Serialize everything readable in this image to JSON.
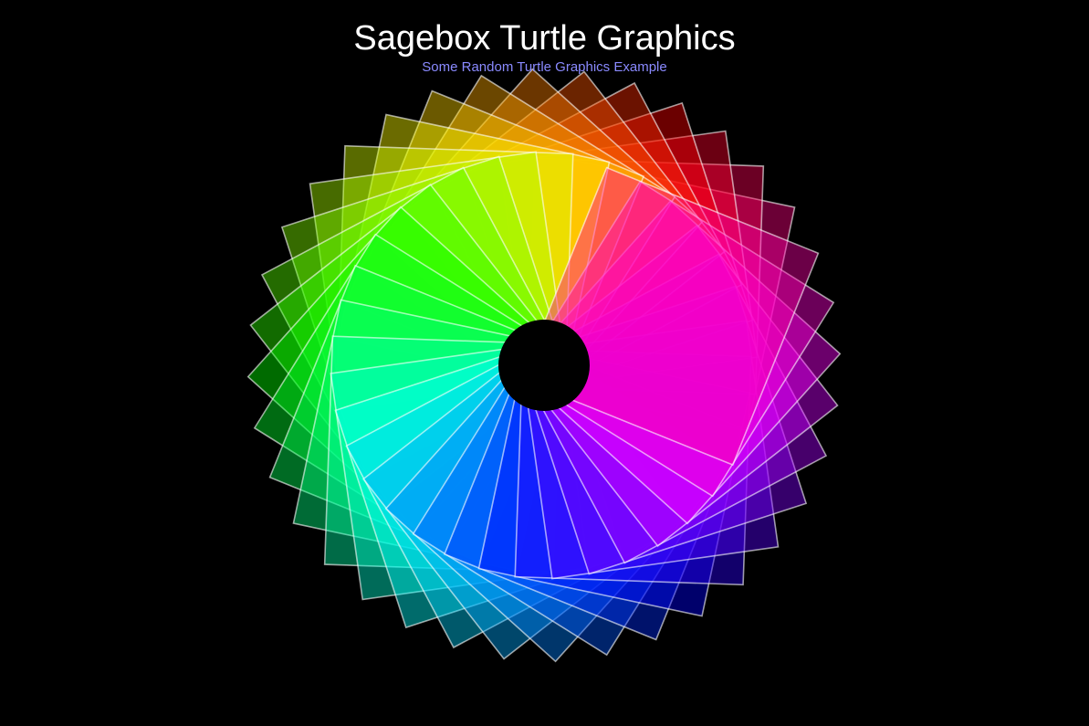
{
  "window": {
    "title": "Sagebox Turtle Graphics",
    "subtitle": "Some Random Turtle Graphics Example"
  },
  "colors": {
    "background": "#000000",
    "title": "#ffffff",
    "subtitle": "#8a8aff",
    "outline": "#ffffff",
    "hole": "#000000"
  },
  "turtle_art": {
    "description_shape": "rotated-squares",
    "square_count": 36,
    "hue_gradient": "full-spectrum"
  }
}
